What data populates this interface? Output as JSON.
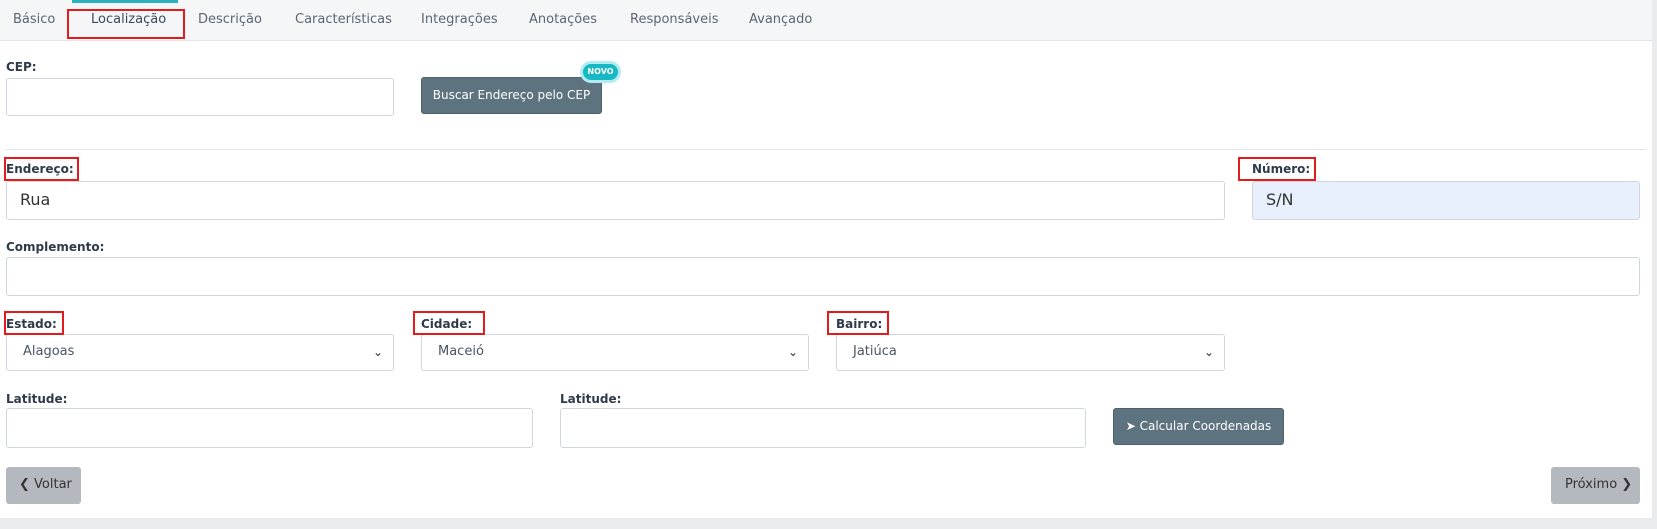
{
  "tabs": [
    {
      "label": "Básico"
    },
    {
      "label": "Localização"
    },
    {
      "label": "Descrição"
    },
    {
      "label": "Características"
    },
    {
      "label": "Integrações"
    },
    {
      "label": "Anotações"
    },
    {
      "label": "Responsáveis"
    },
    {
      "label": "Avançado"
    }
  ],
  "form": {
    "cep_label": "CEP:",
    "cep_value": "",
    "search_button": "Buscar Endereço pelo CEP",
    "new_badge": "NOVO",
    "endereco_label": "Endereço:",
    "endereco_value": "Rua",
    "numero_label": "Número:",
    "numero_value": "S/N",
    "complemento_label": "Complemento:",
    "complemento_value": "",
    "estado_label": "Estado:",
    "estado_value": "Alagoas",
    "cidade_label": "Cidade:",
    "cidade_value": "Maceió",
    "bairro_label": "Bairro:",
    "bairro_value": "Jatiúca",
    "latitude_label": "Latitude:",
    "latitude_value": "",
    "latitude2_label": "Latitude:",
    "latitude2_value": "",
    "calc_button": "Calcular Coordenadas"
  },
  "nav": {
    "back": "Voltar",
    "next": "Próximo"
  },
  "colors": {
    "accent": "#2bb0c0",
    "button_dark": "#5e7380",
    "highlight": "#e41b1b"
  }
}
